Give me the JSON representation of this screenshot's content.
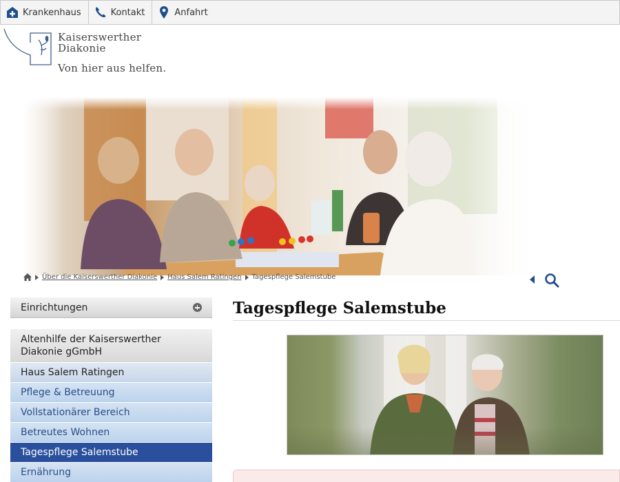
{
  "topbar": {
    "items": [
      {
        "label": "Krankenhaus",
        "icon": "hospital-cross-icon"
      },
      {
        "label": "Kontakt",
        "icon": "phone-icon"
      },
      {
        "label": "Anfahrt",
        "icon": "map-pin-icon"
      }
    ]
  },
  "logo": {
    "name_line1": "Kaiserswerther",
    "name_line2": "Diakonie",
    "tagline": "Von hier aus helfen."
  },
  "breadcrumb": {
    "items": [
      {
        "label": "Über die Kaiserswerther Diakonie"
      },
      {
        "label": "Haus Salem Ratingen"
      },
      {
        "label": "Tagespflege Salemstube"
      }
    ]
  },
  "sidebar": {
    "section_label": "Einrichtungen",
    "parent_label": "Altenhilfe der Kaiserswerther Diakonie gGmbH",
    "items": [
      {
        "label": "Haus Salem Ratingen"
      },
      {
        "label": "Pflege & Betreuung"
      },
      {
        "label": "Vollstationärer Bereich"
      },
      {
        "label": "Betreutes Wohnen"
      },
      {
        "label": "Tagespflege Salemstube"
      },
      {
        "label": "Ernährung"
      }
    ]
  },
  "main": {
    "title": "Tagespflege Salemstube"
  },
  "colors": {
    "accent": "#2a4f9c",
    "nav_bg": "#c8d9ef",
    "icon_blue": "#1f4e8c"
  }
}
